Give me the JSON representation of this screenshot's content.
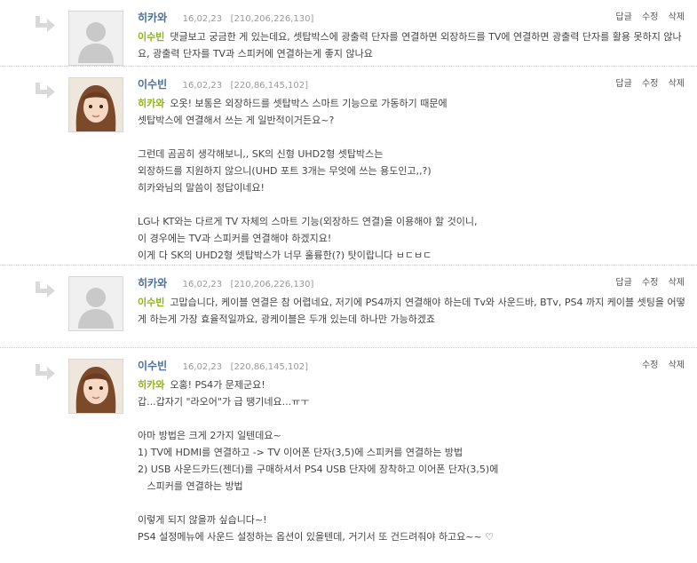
{
  "comments": [
    {
      "author": "히카와",
      "date": "16,02,23",
      "ip": "[210,206,226,130]",
      "actions": [
        "답글",
        "수정",
        "삭제"
      ],
      "mention": "이수빈",
      "text": "댓글보고 궁금한 게 있는데요, 셋탑박스에 광출력 단자를 연결하면 외장하드를 TV에 연결하면 광출력 단자를 활용 못하지 않나요, 광출력 단자를 TV과 스피커에 연결하는게 좋지 않나요"
    },
    {
      "author": "이수빈",
      "date": "16,02,23",
      "ip": "[220,86,145,102]",
      "actions": [
        "답글",
        "수정",
        "삭제"
      ],
      "mention": "히카와",
      "lines": [
        "오옷! 보통은 외장하드를 셋탑박스 스마트 기능으로 가동하기 때문에",
        "셋탑박스에 연결해서 쓰는 게 일반적이거든요~?",
        "",
        "그런데 곰곰히 생각해보니,, SK의 신형 UHD2형 셋탑박스는",
        "외장하드를 지원하지 않으니(UHD 포트 3개는 무엇에 쓰는 용도인고,,?)",
        "히카와님의 말씀이 정답이네요!",
        "",
        "LG나 KT와는 다르게 TV 자체의 스마트 기능(외장하드 연결)을 이용해야 할 것이니,",
        "이 경우에는 TV과 스피커를 연결해야 하겠지요!",
        "이게 다 SK의 UHD2형 셋탑박스가 너무 훌륭한(?) 탓이랍니다 ㅂㄷㅂㄷ"
      ]
    },
    {
      "author": "히카와",
      "date": "16,02,23",
      "ip": "[210,206,226,130]",
      "actions": [
        "답글",
        "수정",
        "삭제"
      ],
      "mention": "이수빈",
      "text": "고맙습니다, 케이블 연결은 참 어렵네요, 저기에 PS4까지 연결해야 하는데 Tv와 사운드바, BTv, PS4 까지 케이블 셋팅을 어떻게 하는게 가장 효율적일까요, 광케이블은 두개 있는데 하나만 가능하겠죠"
    },
    {
      "author": "이수빈",
      "date": "16,02,23",
      "ip": "[220,86,145,102]",
      "actions": [
        "수정",
        "삭제"
      ],
      "mention": "히카와",
      "lines": [
        "오홍! PS4가 문제군요!",
        "갑...갑자기 \"라오어\"가 급 땡기네요...ㅠㅜ",
        "",
        "아마 방법은 크게 2가지 일텐데요~",
        "1) TV에 HDMI를 연결하고 -> TV 이어폰 단자(3,5)에 스피커를 연결하는 방법",
        "2) USB 사운드카드(젠더)를 구매하셔서 PS4 USB 단자에 장착하고 이어폰 단자(3,5)에",
        "   스피커를 연결하는 방법",
        "",
        "이렇게 되지 않을까 싶습니다~!",
        "PS4 설정메뉴에 사운드 설정하는 옵션이 있을텐데, 거기서 또 건드려줘야 하고요~~ ♡"
      ]
    }
  ]
}
